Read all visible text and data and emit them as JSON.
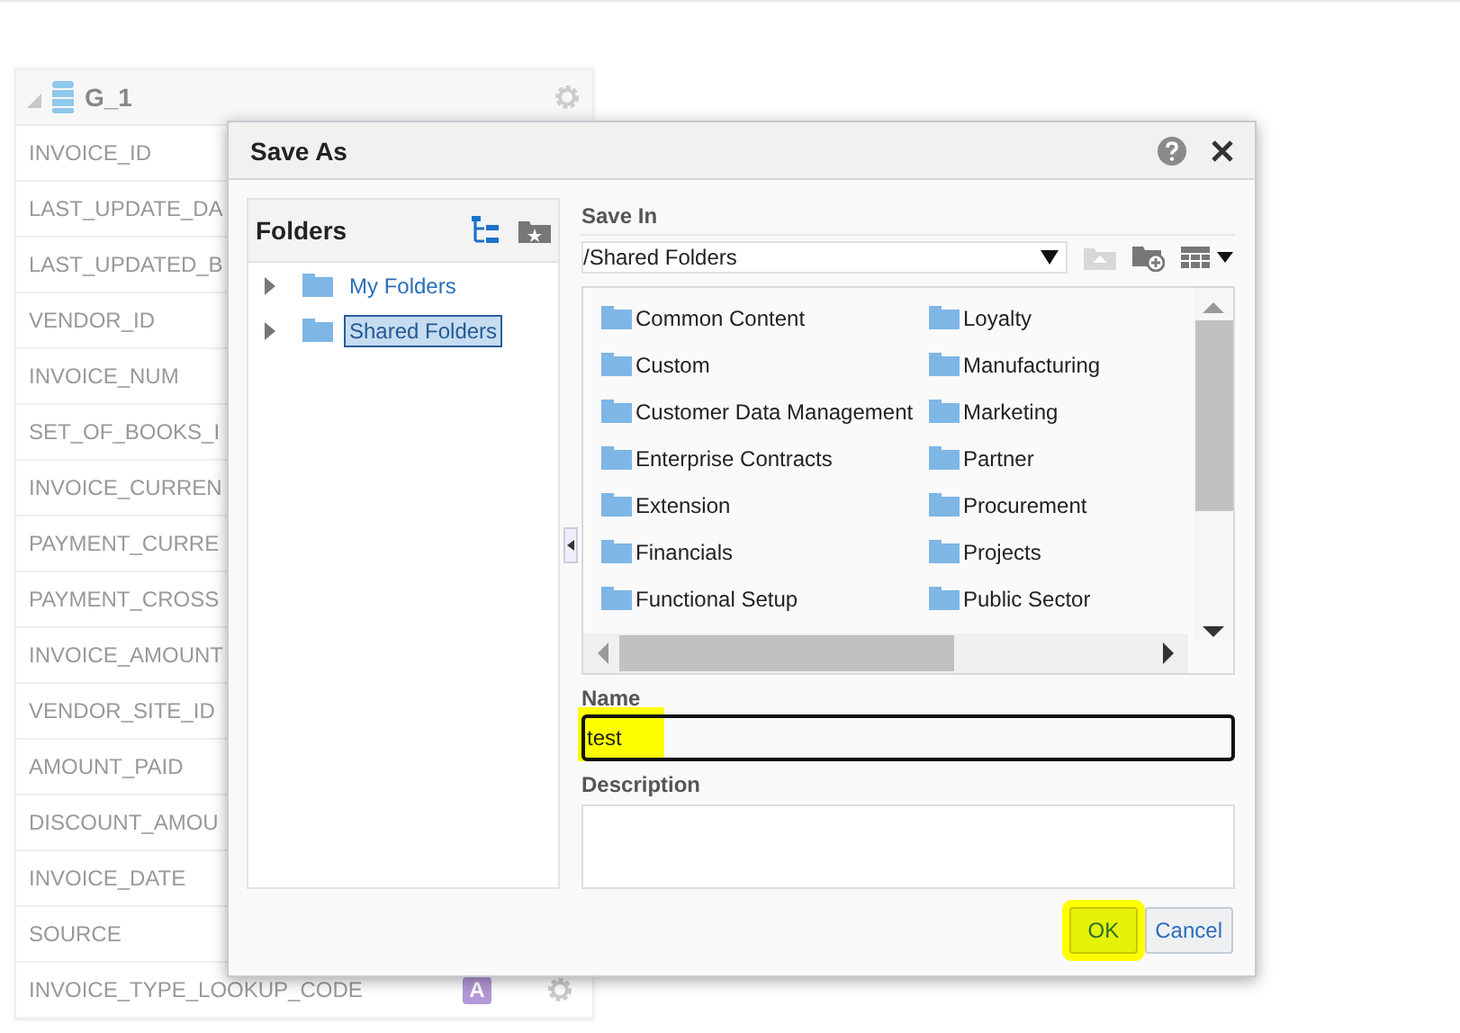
{
  "data_set": {
    "title": "G_1",
    "rows": [
      {
        "label": "INVOICE_ID"
      },
      {
        "label": "LAST_UPDATE_DA"
      },
      {
        "label": "LAST_UPDATED_B"
      },
      {
        "label": "VENDOR_ID"
      },
      {
        "label": "INVOICE_NUM"
      },
      {
        "label": "SET_OF_BOOKS_I"
      },
      {
        "label": "INVOICE_CURREN"
      },
      {
        "label": "PAYMENT_CURRE"
      },
      {
        "label": "PAYMENT_CROSS"
      },
      {
        "label": "INVOICE_AMOUNT"
      },
      {
        "label": "VENDOR_SITE_ID"
      },
      {
        "label": "AMOUNT_PAID"
      },
      {
        "label": "DISCOUNT_AMOU"
      },
      {
        "label": "INVOICE_DATE"
      },
      {
        "label": "SOURCE"
      },
      {
        "label": "INVOICE_TYPE_LOOKUP_CODE",
        "badge": "A"
      }
    ]
  },
  "dialog": {
    "title": "Save As",
    "folders": {
      "title": "Folders",
      "items": [
        {
          "label": "My Folders",
          "selected": false
        },
        {
          "label": "Shared Folders",
          "selected": true
        }
      ]
    },
    "save_in": {
      "label": "Save In",
      "value": "/Shared Folders"
    },
    "files": [
      {
        "label": "Common Content"
      },
      {
        "label": "Custom"
      },
      {
        "label": "Customer Data Management"
      },
      {
        "label": "Enterprise Contracts"
      },
      {
        "label": "Extension"
      },
      {
        "label": "Financials"
      },
      {
        "label": "Functional Setup"
      },
      {
        "label": "Loyalty"
      },
      {
        "label": "Manufacturing"
      },
      {
        "label": "Marketing"
      },
      {
        "label": "Partner"
      },
      {
        "label": "Procurement"
      },
      {
        "label": "Projects"
      },
      {
        "label": "Public Sector"
      }
    ],
    "name": {
      "label": "Name",
      "value": "test",
      "highlighted": true
    },
    "description": {
      "label": "Description"
    },
    "buttons": [
      {
        "label": "OK",
        "highlighted": true
      },
      {
        "label": "Cancel",
        "highlighted": false
      }
    ]
  }
}
